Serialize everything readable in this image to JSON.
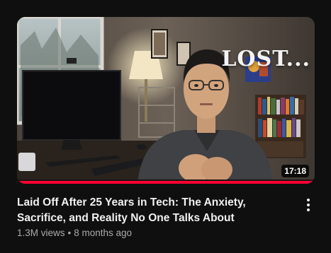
{
  "video": {
    "thumbnail_overlay_text": "LOST...",
    "duration": "17:18",
    "watch_progress_percent": 100,
    "title": "Laid Off After 25 Years in Tech: The Anxiety, Sacrifice, and Reality No One Talks About",
    "views": "1.3M views",
    "separator": "•",
    "age": "8 months ago",
    "menu_icon": "more-vert-icon"
  },
  "colors": {
    "background": "#0f0f0f",
    "progress": "#ff0033",
    "title": "#f1f1f1",
    "meta": "#aaaaaa"
  }
}
